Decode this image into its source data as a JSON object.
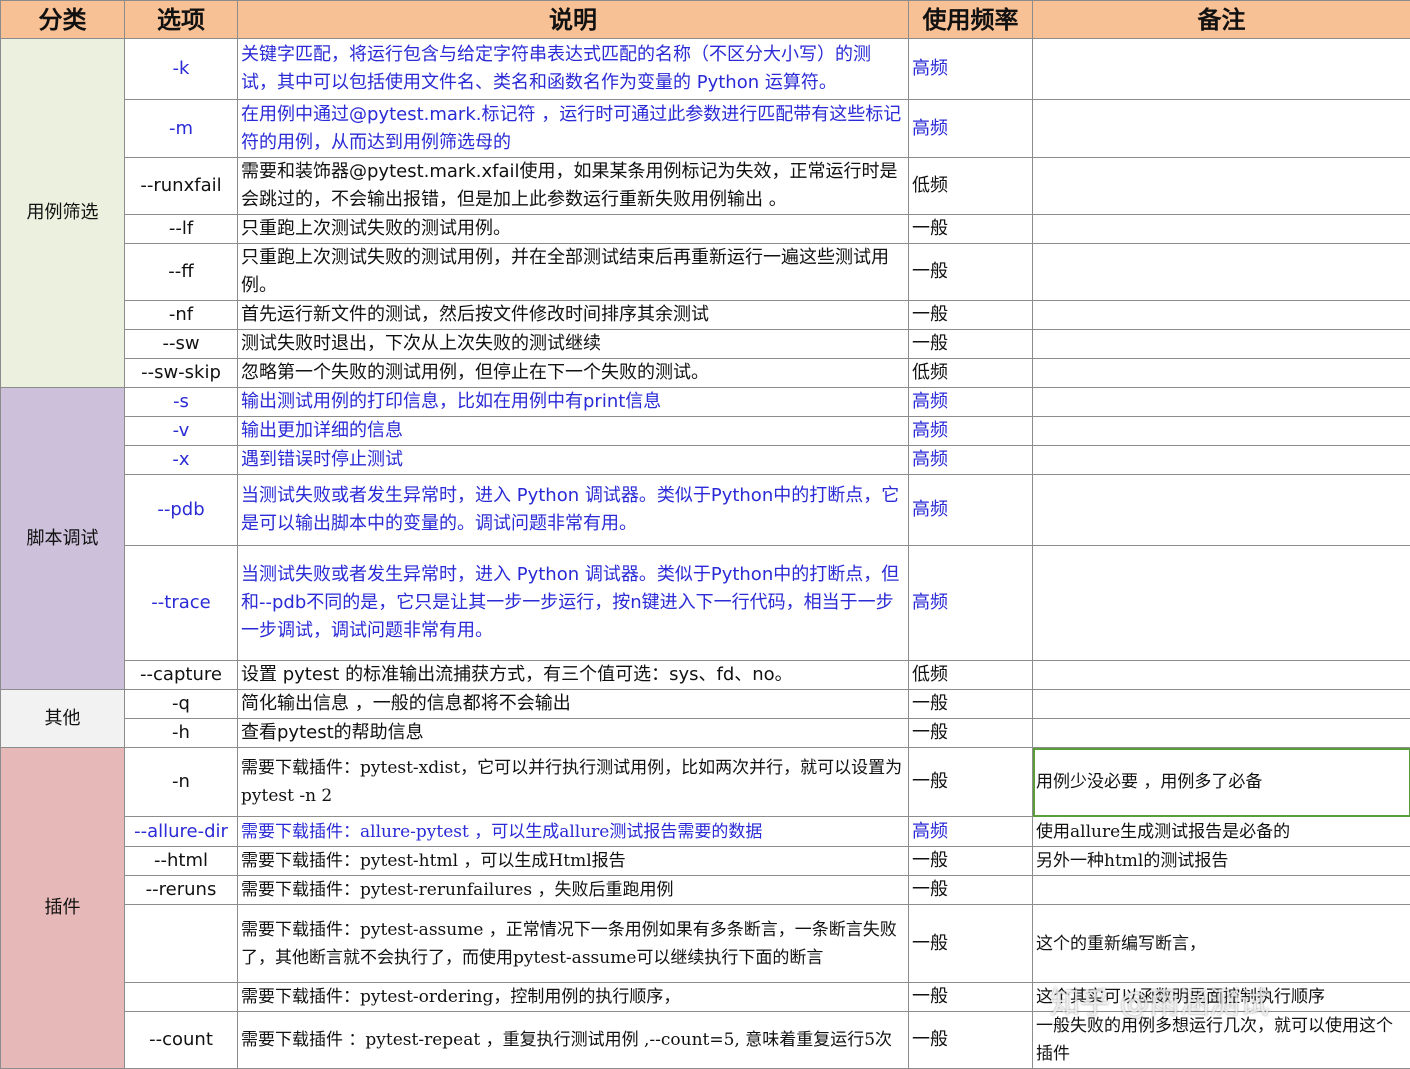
{
  "headers": [
    "分类",
    "选项",
    "说明",
    "使用频率",
    "备注"
  ],
  "categories": [
    {
      "label": "用例筛选",
      "rows": 8,
      "color": "#ebf1de"
    },
    {
      "label": "脚本调试",
      "rows": 6,
      "color": "#ccc0da"
    },
    {
      "label": "其他",
      "rows": 2,
      "color": "#f2f2f2"
    },
    {
      "label": "插件",
      "rows": 7,
      "color": "#e6b8b7"
    }
  ],
  "rows": [
    {
      "option": "-k",
      "desc": "关键字匹配，将运行包含与给定字符串表达式匹配的名称（不区分大小写）的测试，其中可以包括使用文件名、类名和函数名作为变量的 Python 运算符。",
      "freq": "高频",
      "note": "",
      "blue": true
    },
    {
      "option": "-m",
      "desc": "在用例中通过@pytest.mark.标记符 ，运行时可通过此参数进行匹配带有这些标记符的用例，从而达到用例筛选母的",
      "freq": "高频",
      "note": "",
      "blue": true
    },
    {
      "option": "--runxfail",
      "desc": "需要和装饰器@pytest.mark.xfail使用，如果某条用例标记为失效，正常运行时是会跳过的，不会输出报错，但是加上此参数运行重新失败用例输出 。",
      "freq": "低频",
      "note": ""
    },
    {
      "option": "--lf",
      "desc": "只重跑上次测试失败的测试用例。",
      "freq": "一般",
      "note": ""
    },
    {
      "option": "--ff",
      "desc": "只重跑上次测试失败的测试用例，并在全部测试结束后再重新运行一遍这些测试用例。",
      "freq": "一般",
      "note": ""
    },
    {
      "option": "-nf",
      "desc": "首先运行新文件的测试，然后按文件修改时间排序其余测试",
      "freq": "一般",
      "note": ""
    },
    {
      "option": "--sw",
      "desc": "测试失败时退出，下次从上次失败的测试继续",
      "freq": "一般",
      "note": ""
    },
    {
      "option": "--sw-skip",
      "desc": "忽略第一个失败的测试用例，但停止在下一个失败的测试。",
      "freq": "低频",
      "note": ""
    },
    {
      "option": "-s",
      "desc": "输出测试用例的打印信息，比如在用例中有print信息",
      "freq": "高频",
      "note": "",
      "blue": true
    },
    {
      "option": "-v",
      "desc": "输出更加详细的信息",
      "freq": "高频",
      "note": "",
      "blue": true
    },
    {
      "option": "-x",
      "desc": "遇到错误时停止测试",
      "freq": "高频",
      "note": "",
      "blue": true
    },
    {
      "option": "--pdb",
      "desc": "当测试失败或者发生异常时，进入 Python 调试器。类似于Python中的打断点，它是可以输出脚本中的变量的。调试问题非常有用。",
      "freq": "高频",
      "note": "",
      "blue": true
    },
    {
      "option": "--trace",
      "desc": "当测试失败或者发生异常时，进入 Python 调试器。类似于Python中的打断点，但和--pdb不同的是，它只是让其一步一步运行，按n键进入下一行代码，相当于一步一步调试，调试问题非常有用。",
      "freq": "高频",
      "note": "",
      "blue": true
    },
    {
      "option": "--capture",
      "desc": "设置 pytest 的标准输出流捕获方式，有三个值可选：sys、fd、no。",
      "freq": "低频",
      "note": ""
    },
    {
      "option": "-q",
      "desc": "简化输出信息 ，一般的信息都将不会输出",
      "freq": "一般",
      "note": ""
    },
    {
      "option": "-h",
      "desc": "查看pytest的帮助信息",
      "freq": "一般",
      "note": ""
    },
    {
      "option": "-n",
      "desc": "需要下载插件：pytest-xdist，它可以并行执行测试用例，比如两次并行，就可以设置为pytest -n 2",
      "freq": "一般",
      "note": "用例少没必要 ，用例多了必备",
      "serif": true,
      "hl": true
    },
    {
      "option": "--allure-dir",
      "desc": "需要下载插件：allure-pytest ，可以生成allure测试报告需要的数据",
      "freq": "高频",
      "note": "使用allure生成测试报告是必备的",
      "serif": true,
      "blue": true
    },
    {
      "option": "--html",
      "desc": "需要下载插件：pytest-html ，可以生成Html报告",
      "freq": "一般",
      "note": "另外一种html的测试报告",
      "serif": true
    },
    {
      "option": "--reruns",
      "desc": "需要下载插件：pytest-rerunfailures ，失败后重跑用例",
      "freq": "一般",
      "note": "",
      "serif": true
    },
    {
      "option": "",
      "desc": "需要下载插件：pytest-assume ，正常情况下一条用例如果有多条断言，一条断言失败了，其他断言就不会执行了，而使用pytest-assume可以继续执行下面的断言",
      "freq": "一般",
      "note": "这个的重新编写断言，",
      "serif": true
    },
    {
      "option": "",
      "desc": "需要下载插件：pytest-ordering，控制用例的执行顺序，",
      "freq": "一般",
      "note": "这个其实可以函数明里面控制执行顺序",
      "serif": true
    },
    {
      "option": "--count",
      "desc": "需要下载插件 ：pytest-repeat ，重复执行测试用例 ,--count=5, 意味着重复运行5次",
      "freq": "一般",
      "note": "一般失败的用例多想运行几次，就可以使用这个插件",
      "serif": true
    }
  ],
  "watermark": "知乎 @雨涵测试"
}
